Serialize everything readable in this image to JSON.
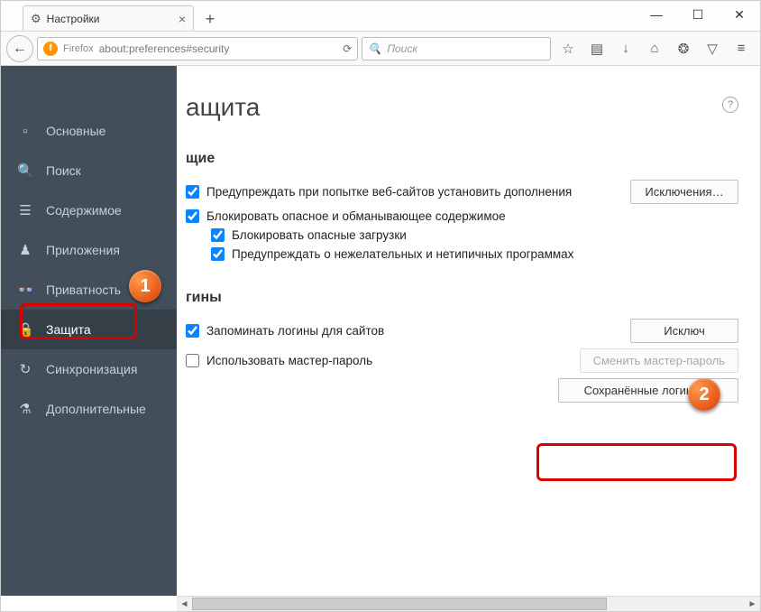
{
  "window": {
    "tab_title": "Настройки",
    "newtab_glyph": "+",
    "controls": {
      "min": "—",
      "max": "☐",
      "close": "✕"
    }
  },
  "navbar": {
    "back_glyph": "←",
    "ff_label": "Firefox",
    "url": "about:preferences#security",
    "reload_glyph": "⟳",
    "search_placeholder": "Поиск",
    "search_glyph": "🔍",
    "icons": {
      "bookmark": "☆",
      "library": "▤",
      "downloads": "↓",
      "home": "⌂",
      "sync": "❂",
      "pocket": "▽",
      "menu": "≡"
    }
  },
  "sidebar": {
    "items": [
      {
        "icon": "▫",
        "label": "Основные"
      },
      {
        "icon": "🔍",
        "label": "Поиск"
      },
      {
        "icon": "☰",
        "label": "Содержимое"
      },
      {
        "icon": "♟",
        "label": "Приложения"
      },
      {
        "icon": "👓",
        "label": "Приватность"
      },
      {
        "icon": "🔒",
        "label": "Защита"
      },
      {
        "icon": "↻",
        "label": "Синхронизация"
      },
      {
        "icon": "⚗",
        "label": "Дополнительные"
      }
    ],
    "active_index": 5
  },
  "main": {
    "title_visible_fragment": "ащита",
    "help_glyph": "?",
    "section1_heading_fragment": "щие",
    "warn_addons": "Предупреждать при попытке веб-сайтов установить дополнения",
    "exceptions_btn": "Исключения…",
    "block_dangerous": "Блокировать опасное и обманывающее содержимое",
    "block_downloads": "Блокировать опасные загрузки",
    "warn_unwanted": "Предупреждать о нежелательных и нетипичных программах",
    "section2_heading_fragment": "гины",
    "remember_logins": "Запоминать логины для сайтов",
    "exceptions2_fragment": "Исключ",
    "use_master": "Использовать мастер-пароль",
    "change_master": "Сменить мастер-пароль",
    "saved_logins_btn": "Сохранённые логины…"
  },
  "markers": {
    "one": "1",
    "two": "2"
  },
  "colors": {
    "sidebar_bg": "#424f5a",
    "accent_check": "#0a84ff",
    "marker_orange": "#d83b00",
    "highlight_red": "#d80000"
  }
}
